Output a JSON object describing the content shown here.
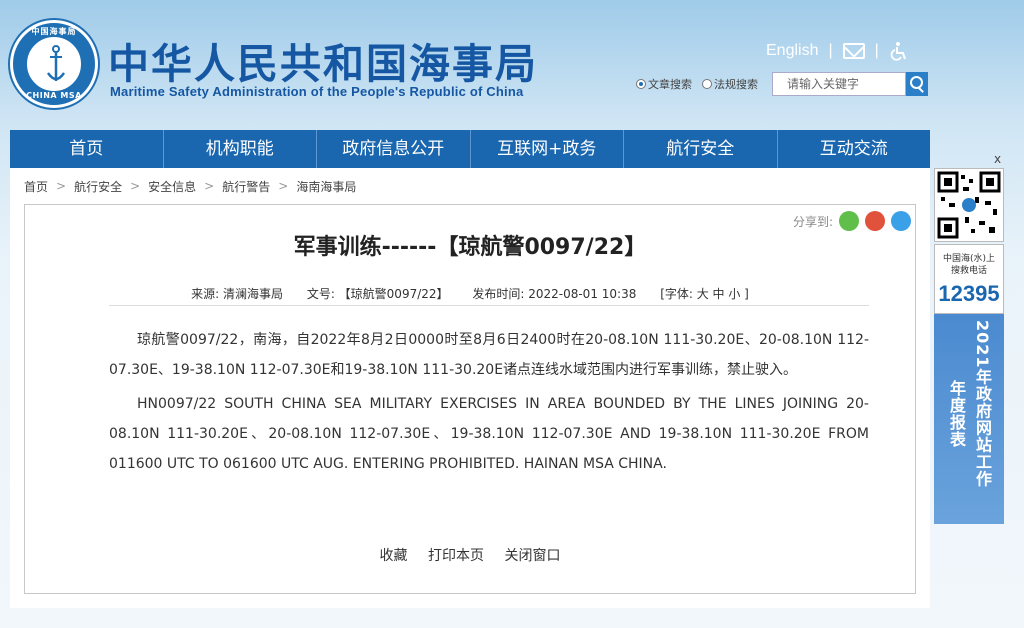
{
  "header": {
    "logo_top_text": "中国海事局",
    "logo_bottom_text": "CHINA MSA",
    "site_title": "中华人民共和国海事局",
    "site_subtitle": "Maritime Safety Administration of the People's Republic of China",
    "english_link": "English",
    "search": {
      "option_article": "文章搜索",
      "option_law": "法规搜索",
      "placeholder": "请输入关键字"
    }
  },
  "nav": {
    "items": [
      "首页",
      "机构职能",
      "政府信息公开",
      "互联网+政务",
      "航行安全",
      "互动交流"
    ]
  },
  "breadcrumb": {
    "items": [
      "首页",
      "航行安全",
      "安全信息",
      "航行警告",
      "海南海事局"
    ]
  },
  "article": {
    "share_label": "分享到:",
    "title": "军事训练------【琼航警0097/22】",
    "meta": {
      "source": "来源:  清澜海事局",
      "doc_no": "文号:  【琼航警0097/22】",
      "publish_time": "发布时间:  2022-08-01 10:38",
      "font_size": "[字体:  大  中  小 ]"
    },
    "paragraph_cn": "琼航警0097/22，南海，自2022年8月2日0000时至8月6日2400时在20-08.10N 111-30.20E、20-08.10N 112-07.30E、19-38.10N 112-07.30E和19-38.10N 111-30.20E诸点连线水域范围内进行军事训练，禁止驶入。",
    "paragraph_en": "HN0097/22 SOUTH CHINA SEA MILITARY EXERCISES IN AREA BOUNDED BY THE LINES JOINING 20-08.10N 111-30.20E、20-08.10N 112-07.30E、19-38.10N 112-07.30E AND 19-38.10N 111-30.20E FROM 011600 UTC TO 061600 UTC AUG. ENTERING PROHIBITED. HAINAN MSA CHINA.",
    "actions": [
      "收藏",
      "打印本页",
      "关闭窗口"
    ]
  },
  "sidebar": {
    "close": "x",
    "hotline_label_1": "中国海(水)上",
    "hotline_label_2": "搜救电话",
    "hotline_number": "12395",
    "report_col_1": "2021年政府网站工作",
    "report_col_2": "年度报表"
  },
  "colors": {
    "brand_blue": "#1a67b0",
    "title_blue": "#1557a3",
    "wechat": "#5fbf4a",
    "weibo": "#e0523c",
    "qzone": "#3aa0e8"
  }
}
